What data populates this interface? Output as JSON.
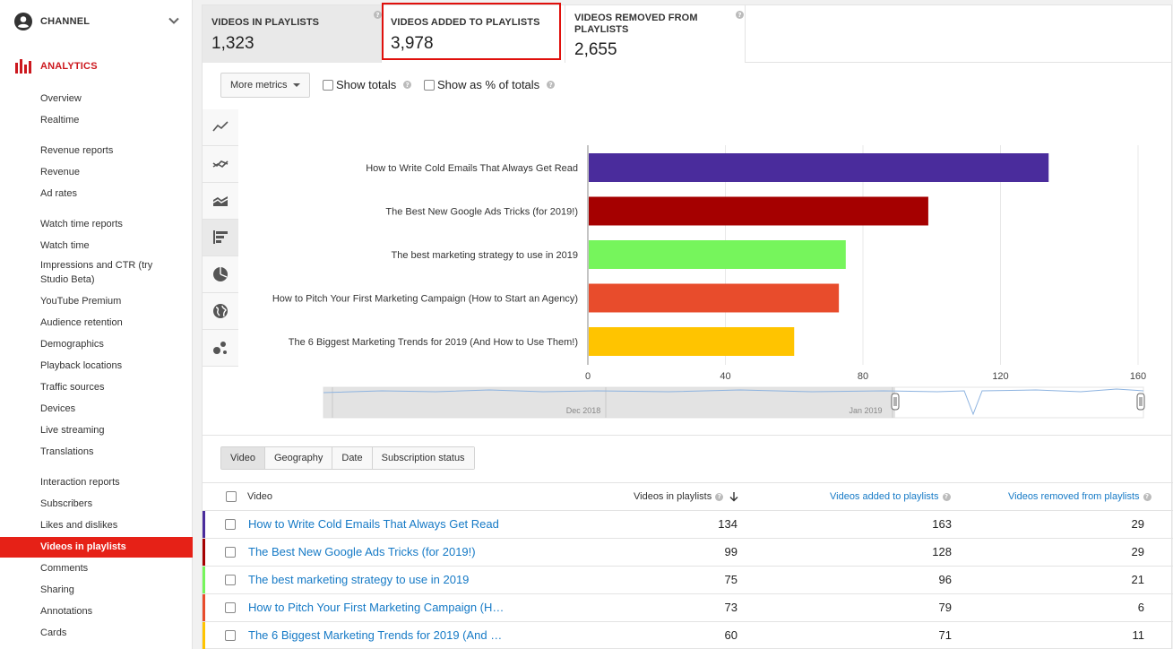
{
  "sidebar": {
    "channel_label": "CHANNEL",
    "analytics_label": "ANALYTICS",
    "items": [
      {
        "label": "Overview",
        "type": "item"
      },
      {
        "label": "Realtime",
        "type": "item"
      },
      {
        "label": "Revenue reports",
        "type": "header"
      },
      {
        "label": "Revenue",
        "type": "item"
      },
      {
        "label": "Ad rates",
        "type": "item"
      },
      {
        "label": "Watch time reports",
        "type": "header"
      },
      {
        "label": "Watch time",
        "type": "item"
      },
      {
        "label": "Impressions and CTR (try",
        "label2": "Studio Beta)",
        "type": "item"
      },
      {
        "label": "YouTube Premium",
        "type": "item"
      },
      {
        "label": "Audience retention",
        "type": "item"
      },
      {
        "label": "Demographics",
        "type": "item"
      },
      {
        "label": "Playback locations",
        "type": "item"
      },
      {
        "label": "Traffic sources",
        "type": "item"
      },
      {
        "label": "Devices",
        "type": "item"
      },
      {
        "label": "Live streaming",
        "type": "item"
      },
      {
        "label": "Translations",
        "type": "item"
      },
      {
        "label": "Interaction reports",
        "type": "header"
      },
      {
        "label": "Subscribers",
        "type": "item"
      },
      {
        "label": "Likes and dislikes",
        "type": "item"
      },
      {
        "label": "Videos in playlists",
        "type": "selected"
      },
      {
        "label": "Comments",
        "type": "item"
      },
      {
        "label": "Sharing",
        "type": "item"
      },
      {
        "label": "Annotations",
        "type": "item"
      },
      {
        "label": "Cards",
        "type": "item"
      }
    ]
  },
  "metrics": [
    {
      "label": "VIDEOS IN PLAYLISTS",
      "label2": "",
      "value": "1,323"
    },
    {
      "label": "VIDEOS ADDED TO PLAYLISTS",
      "label2": "",
      "value": "3,978"
    },
    {
      "label": "VIDEOS REMOVED FROM",
      "label2": "PLAYLISTS",
      "value": "2,655"
    }
  ],
  "options": {
    "more_metrics": "More metrics",
    "show_totals": "Show totals",
    "show_percent": "Show as % of totals"
  },
  "chart_tabs": [
    "line-chart-icon",
    "multi-line-chart-icon",
    "stacked-area-chart-icon",
    "bar-chart-icon",
    "pie-chart-icon",
    "globe-map-icon",
    "bubble-chart-icon"
  ],
  "chart_data": {
    "type": "bar",
    "orientation": "horizontal",
    "categories": [
      "How to Write Cold Emails That Always Get Read",
      "The Best New Google Ads Tricks (for 2019!)",
      "The best marketing strategy to use in 2019",
      "How to Pitch Your First Marketing Campaign (How to Start an Agency)",
      "The 6 Biggest Marketing Trends for 2019 (And How to Use Them!)"
    ],
    "values": [
      134,
      99,
      75,
      73,
      60
    ],
    "colors": [
      "#4a2c9c",
      "#a50000",
      "#76f55c",
      "#e84c2c",
      "#ffc400"
    ],
    "xlim": [
      0,
      160
    ],
    "xticks": [
      "0",
      "40",
      "80",
      "120",
      "160"
    ],
    "grid": true,
    "timeline_labels": [
      "Dec 2018",
      "Jan 2019"
    ]
  },
  "dimension_tabs": [
    "Video",
    "Geography",
    "Date",
    "Subscription status"
  ],
  "table": {
    "headers": {
      "video": "Video",
      "in_playlists": "Videos in playlists",
      "added": "Videos added to playlists",
      "removed": "Videos removed from playlists"
    },
    "rows": [
      {
        "title": "How to Write Cold Emails That Always Get Read",
        "in": "134",
        "added": "163",
        "removed": "29",
        "color": "#4a2c9c"
      },
      {
        "title": "The Best New Google Ads Tricks (for 2019!)",
        "in": "99",
        "added": "128",
        "removed": "29",
        "color": "#a50000"
      },
      {
        "title": "The best marketing strategy to use in 2019",
        "in": "75",
        "added": "96",
        "removed": "21",
        "color": "#76f55c"
      },
      {
        "title": "How to Pitch Your First Marketing Campaign (H…",
        "in": "73",
        "added": "79",
        "removed": "6",
        "color": "#e84c2c"
      },
      {
        "title": "The 6 Biggest Marketing Trends for 2019 (And …",
        "in": "60",
        "added": "71",
        "removed": "11",
        "color": "#ffc400"
      }
    ]
  }
}
